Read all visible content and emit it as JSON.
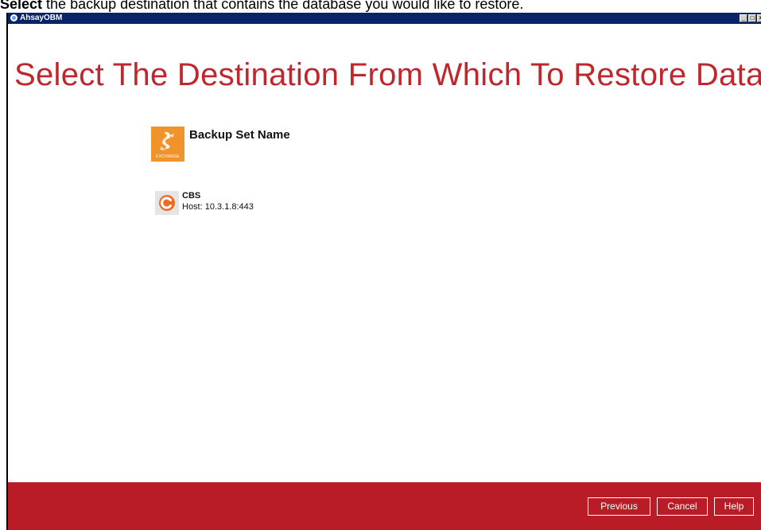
{
  "caption": {
    "bold": "Select",
    "rest": " the backup destination that contains the database you would like to restore."
  },
  "window": {
    "title": "AhsayOBM",
    "controls": {
      "minimize": "_",
      "maximize": "□",
      "close": "×"
    }
  },
  "page": {
    "title": "Select The Destination From Which To Restore Data"
  },
  "backup_set": {
    "label": "Backup Set Name",
    "icon": "exchange-icon",
    "icon_caption": "EXCHANGE"
  },
  "destination": {
    "name": "CBS",
    "host": "Host: 10.3.1.8:443",
    "icon": "cbs-icon"
  },
  "footer": {
    "previous_label": "Previous",
    "cancel_label": "Cancel",
    "help_label": "Help"
  },
  "colors": {
    "titlebar": "#0a2368",
    "title_text": "#c0272d",
    "footer": "#b91c26",
    "exchange_icon": "#f0932b",
    "cbs_icon": "#ee6b24"
  }
}
